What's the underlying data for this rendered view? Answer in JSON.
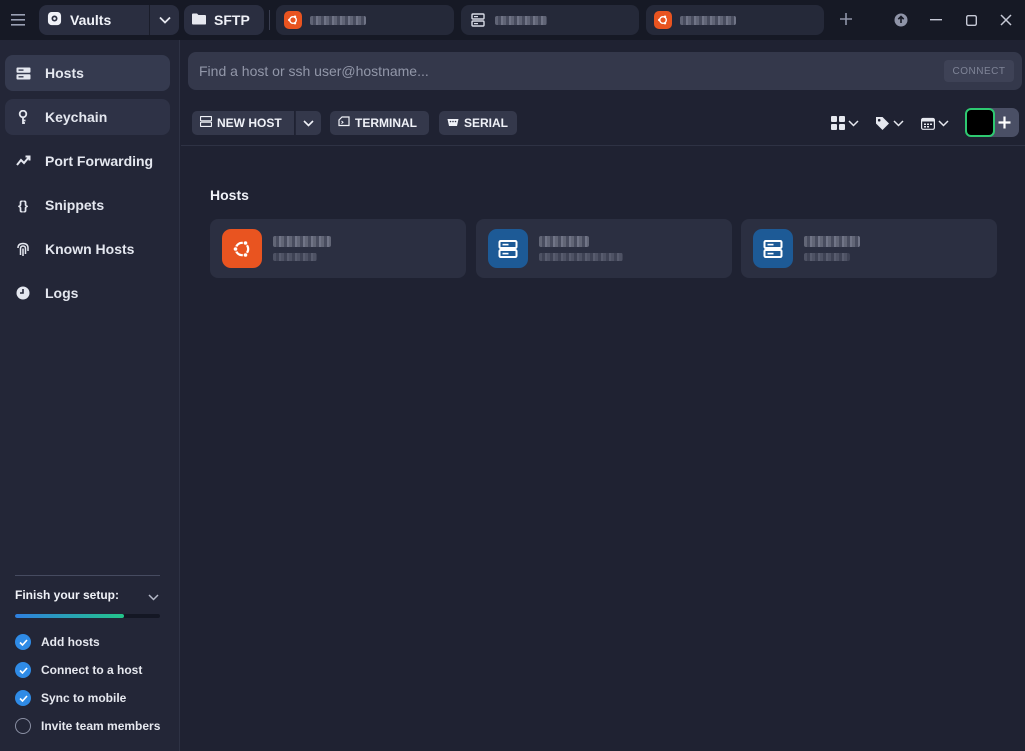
{
  "titlebar": {
    "vault_label": "Vaults",
    "sftp_label": "SFTP",
    "tabs": [
      {
        "icon": "ubuntu-icon",
        "color": "#e95420"
      },
      {
        "icon": "server-icon",
        "color": "#2a2e40"
      },
      {
        "icon": "ubuntu-icon",
        "color": "#e95420"
      }
    ]
  },
  "sidebar": {
    "items": [
      {
        "label": "Hosts",
        "icon": "hosts-icon"
      },
      {
        "label": "Keychain",
        "icon": "key-icon"
      },
      {
        "label": "Port Forwarding",
        "icon": "port-forwarding-icon"
      },
      {
        "label": "Snippets",
        "icon": "snippets-icon"
      },
      {
        "label": "Known Hosts",
        "icon": "fingerprint-icon"
      },
      {
        "label": "Logs",
        "icon": "clock-icon"
      }
    ],
    "setup": {
      "title": "Finish your setup:",
      "progress": 0.75,
      "steps": [
        {
          "label": "Add hosts",
          "done": true
        },
        {
          "label": "Connect to a host",
          "done": true
        },
        {
          "label": "Sync to mobile",
          "done": true
        },
        {
          "label": "Invite team members",
          "done": false
        }
      ]
    }
  },
  "search": {
    "placeholder": "Find a host or ssh user@hostname...",
    "connect_label": "CONNECT"
  },
  "toolbar": {
    "new_host_label": "NEW HOST",
    "terminal_label": "TERMINAL",
    "serial_label": "SERIAL"
  },
  "hosts_section": {
    "title": "Hosts",
    "cards": [
      {
        "type": "ubuntu",
        "color": "#e95420"
      },
      {
        "type": "server",
        "color": "#1d5a96"
      },
      {
        "type": "server",
        "color": "#1d5a96"
      }
    ]
  },
  "colors": {
    "accent": "#2f8be6",
    "success": "#2ec971",
    "ubuntu": "#e95420",
    "server": "#1d5a96"
  }
}
